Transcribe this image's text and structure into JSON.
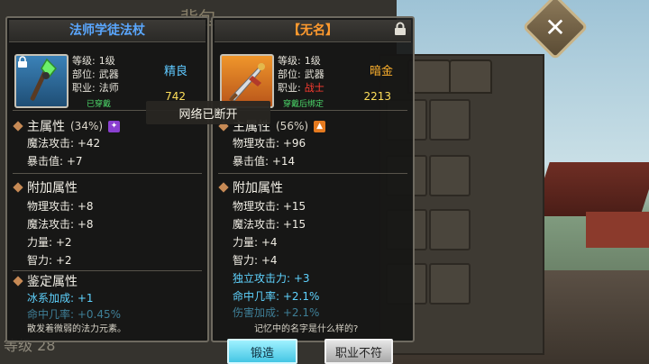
{
  "background": {
    "title_fragment": "背包",
    "level_text": "等级 28"
  },
  "toast": {
    "text": "网络已断开"
  },
  "left_panel": {
    "title": "法师学徒法杖",
    "level": {
      "label": "等级:",
      "value": "1级"
    },
    "slot": {
      "label": "部位:",
      "value": "武器"
    },
    "job": {
      "label": "职业:",
      "value": "法师"
    },
    "grade": "精良",
    "score": "742",
    "status": "已穿戴",
    "main_attr": {
      "label": "主属性",
      "pct": "(34%)",
      "stats": [
        "魔法攻击: +42",
        "暴击值: +7"
      ]
    },
    "extra_attr": {
      "label": "附加属性",
      "stats": [
        "物理攻击: +8",
        "魔法攻击: +8",
        "力量: +2",
        "智力: +2"
      ]
    },
    "identify_attr": {
      "label": "鉴定属性",
      "stats": [
        "冰系加成: +1",
        "命中几率: +0.45%"
      ]
    },
    "description": "散发着微弱的法力元素。"
  },
  "right_panel": {
    "title": "【无名】",
    "level": {
      "label": "等级:",
      "value": "1级"
    },
    "slot": {
      "label": "部位:",
      "value": "武器"
    },
    "job": {
      "label": "职业:",
      "value": "战士"
    },
    "grade": "暗金",
    "score": "2213",
    "status": "穿戴后绑定",
    "main_attr": {
      "label": "主属性",
      "pct": "(56%)",
      "stats": [
        "物理攻击: +96",
        "暴击值: +14"
      ]
    },
    "extra_attr": {
      "label": "附加属性",
      "stats": [
        "物理攻击: +15",
        "魔法攻击: +15",
        "力量: +4",
        "智力: +4"
      ]
    },
    "special_stats": [
      "独立攻击力: +3",
      "命中几率: +2.1%",
      "伤害加成: +2.1%"
    ],
    "question": "记忆中的名字是什么样的?"
  },
  "buttons": {
    "forge": "锻造",
    "job_mismatch": "职业不符"
  },
  "colors": {
    "left_title": "#5aa7ff",
    "right_title": "#ff9a2e",
    "job_mismatch_red": "#ff3b30",
    "bound_green": "#4cd86a",
    "stat_blue": "#5fd3ff"
  },
  "icons": [
    "staff-item-icon",
    "sword-item-icon",
    "lock-icon",
    "close-icon"
  ]
}
